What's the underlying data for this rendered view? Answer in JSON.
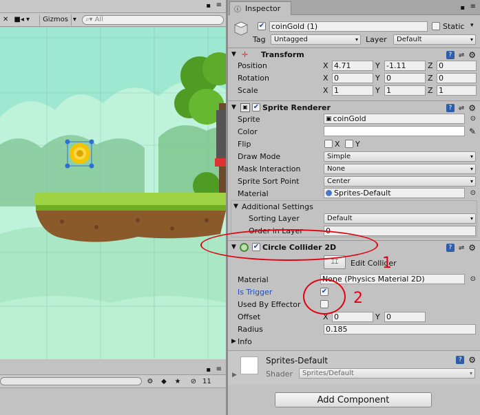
{
  "scene": {
    "gizmos_label": "Gizmos",
    "search_placeholder": "All",
    "visible_count": "11"
  },
  "inspector": {
    "tab_label": "Inspector",
    "object_name": "coinGold (1)",
    "static_label": "Static",
    "tag_label": "Tag",
    "tag_value": "Untagged",
    "layer_label": "Layer",
    "layer_value": "Default",
    "transform": {
      "title": "Transform",
      "position_label": "Position",
      "rotation_label": "Rotation",
      "scale_label": "Scale",
      "position": {
        "x": "4.71",
        "y": "-1.11",
        "z": "0"
      },
      "rotation": {
        "x": "0",
        "y": "0",
        "z": "0"
      },
      "scale": {
        "x": "1",
        "y": "1",
        "z": "1"
      },
      "x": "X",
      "y": "Y",
      "z": "Z"
    },
    "sprite_renderer": {
      "title": "Sprite Renderer",
      "sprite_label": "Sprite",
      "sprite_value": "coinGold",
      "color_label": "Color",
      "flip_label": "Flip",
      "flip_x": "X",
      "flip_y": "Y",
      "draw_mode_label": "Draw Mode",
      "draw_mode_value": "Simple",
      "mask_label": "Mask Interaction",
      "mask_value": "None",
      "sort_point_label": "Sprite Sort Point",
      "sort_point_value": "Center",
      "material_label": "Material",
      "material_value": "Sprites-Default",
      "additional_label": "Additional Settings",
      "sorting_layer_label": "Sorting Layer",
      "sorting_layer_value": "Default",
      "order_label": "Order in Layer",
      "order_value": "0"
    },
    "circle_collider": {
      "title": "Circle Collider 2D",
      "edit_label": "Edit Collider",
      "material_label": "Material",
      "material_value": "None (Physics Material 2D)",
      "is_trigger_label": "Is Trigger",
      "used_by_effector_label": "Used By Effector",
      "offset_label": "Offset",
      "offset_x": "0",
      "offset_y": "0",
      "radius_label": "Radius",
      "radius_value": "0.185",
      "info_label": "Info"
    },
    "material_preview": {
      "name": "Sprites-Default",
      "shader_label": "Shader",
      "shader_value": "Sprites/Default"
    },
    "add_component_label": "Add Component"
  },
  "annotations": [
    "1",
    "2"
  ],
  "colors": {
    "annotation": "#e3000f",
    "sky": "#9ee7d0",
    "grass": "#9ed443",
    "dirt": "#8b5a2b"
  }
}
